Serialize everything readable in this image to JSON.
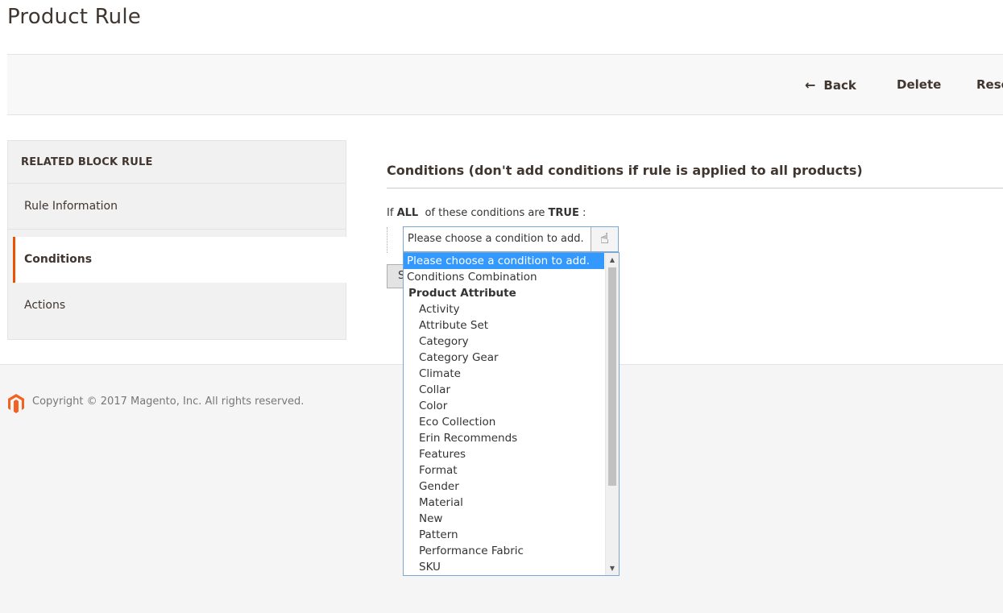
{
  "page": {
    "title": "Product Rule"
  },
  "actions": {
    "back": "Back",
    "delete": "Delete",
    "reset": "Rese"
  },
  "tabs": {
    "heading": "RELATED BLOCK RULE",
    "items": [
      "Rule Information",
      "Conditions",
      "Actions"
    ],
    "active": "Conditions"
  },
  "conditions": {
    "title": "Conditions (don't add conditions if rule is applied to all products)",
    "prefix": "If",
    "aggregator": "ALL",
    "middle": "of these conditions are",
    "value": "TRUE",
    "suffix": ":",
    "select_value": "Please choose a condition to add.",
    "button_label": "S"
  },
  "dropdown": {
    "options": [
      {
        "label": "Please choose a condition to add.",
        "kind": "selected"
      },
      {
        "label": "Conditions Combination",
        "kind": "option"
      },
      {
        "label": "Product Attribute",
        "kind": "group"
      },
      {
        "label": "Activity",
        "kind": "child"
      },
      {
        "label": "Attribute Set",
        "kind": "child"
      },
      {
        "label": "Category",
        "kind": "child"
      },
      {
        "label": "Category Gear",
        "kind": "child"
      },
      {
        "label": "Climate",
        "kind": "child"
      },
      {
        "label": "Collar",
        "kind": "child"
      },
      {
        "label": "Color",
        "kind": "child"
      },
      {
        "label": "Eco Collection",
        "kind": "child"
      },
      {
        "label": "Erin Recommends",
        "kind": "child"
      },
      {
        "label": "Features",
        "kind": "child"
      },
      {
        "label": "Format",
        "kind": "child"
      },
      {
        "label": "Gender",
        "kind": "child"
      },
      {
        "label": "Material",
        "kind": "child"
      },
      {
        "label": "New",
        "kind": "child"
      },
      {
        "label": "Pattern",
        "kind": "child"
      },
      {
        "label": "Performance Fabric",
        "kind": "child"
      },
      {
        "label": "SKU",
        "kind": "child"
      }
    ]
  },
  "footer": {
    "copyright": "Copyright © 2017 Magento, Inc. All rights reserved."
  },
  "icons": {
    "back": "arrow-left-icon",
    "select_button": "hand-pointer-icon",
    "logo": "magento-logo-icon",
    "scroll_up": "triangle-up-icon",
    "scroll_down": "triangle-down-icon"
  },
  "colors": {
    "accent": "#eb5202",
    "selection": "#3399ff",
    "title": "#41362f",
    "logo": "#f26322"
  }
}
